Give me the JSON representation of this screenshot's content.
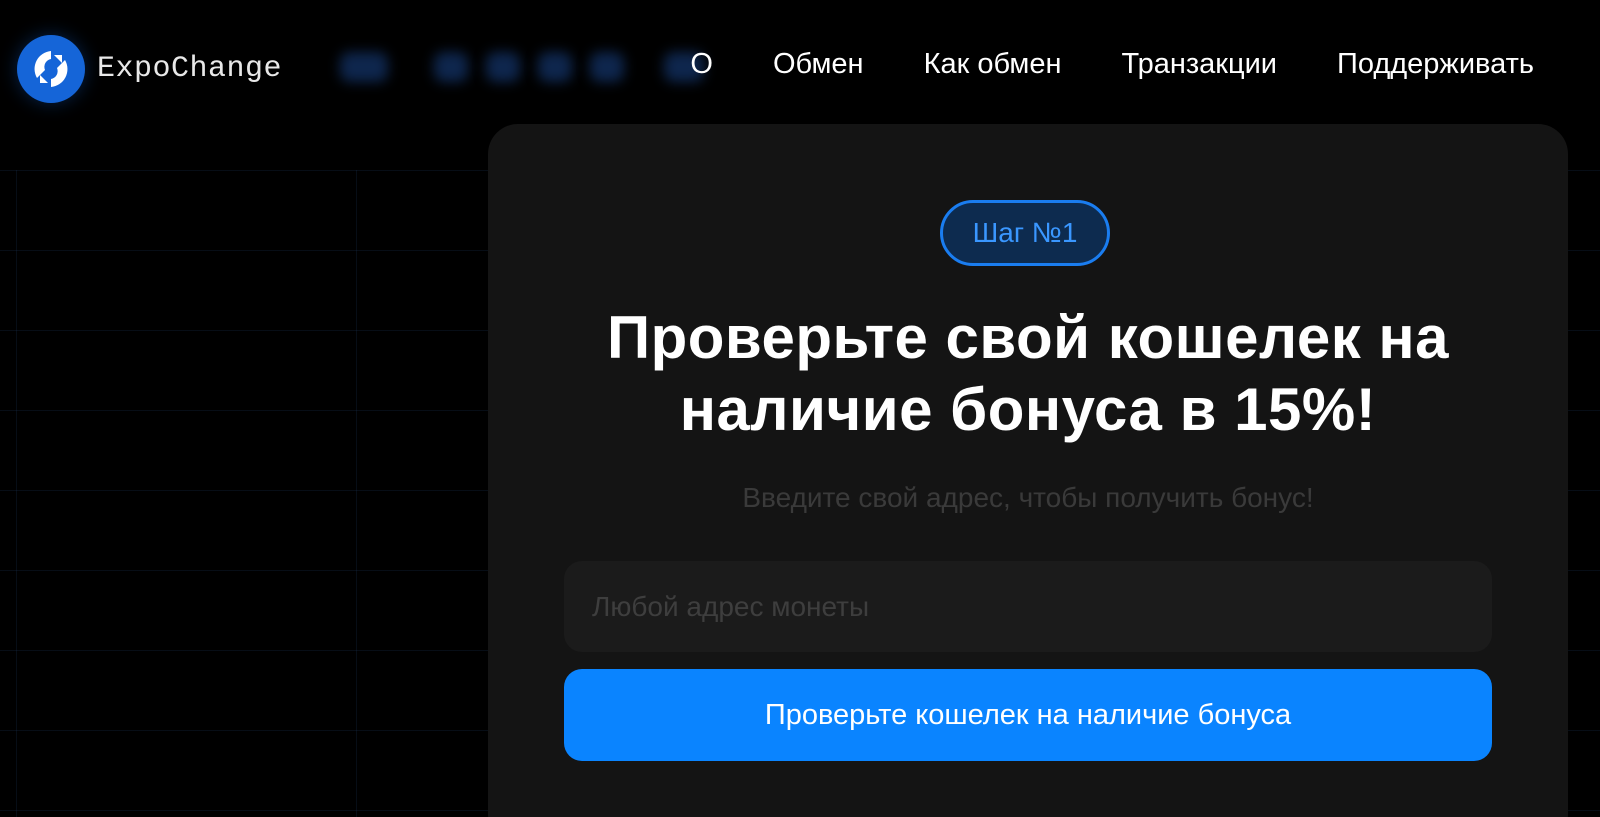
{
  "header": {
    "brand": "ExpoChange",
    "nav": [
      {
        "label": "О"
      },
      {
        "label": "Обмен"
      },
      {
        "label": "Как обмен"
      },
      {
        "label": "Транзакции"
      },
      {
        "label": "Поддерживать"
      }
    ]
  },
  "icons": {
    "logo": "expochange-logo-icon"
  },
  "card": {
    "step_badge": "Шаг №1",
    "title": "Проверьте свой кошелек на наличие бонуса в 15%!",
    "subtitle": "Введите свой адрес, чтобы получить бонус!",
    "address_input": {
      "value": "",
      "placeholder": "Любой адрес монеты"
    },
    "submit_label": "Проверьте кошелек на наличие бонуса"
  },
  "colors": {
    "accent": "#0a84ff",
    "badge_text": "#3a97ff",
    "background": "#000000",
    "card": "#141414"
  }
}
